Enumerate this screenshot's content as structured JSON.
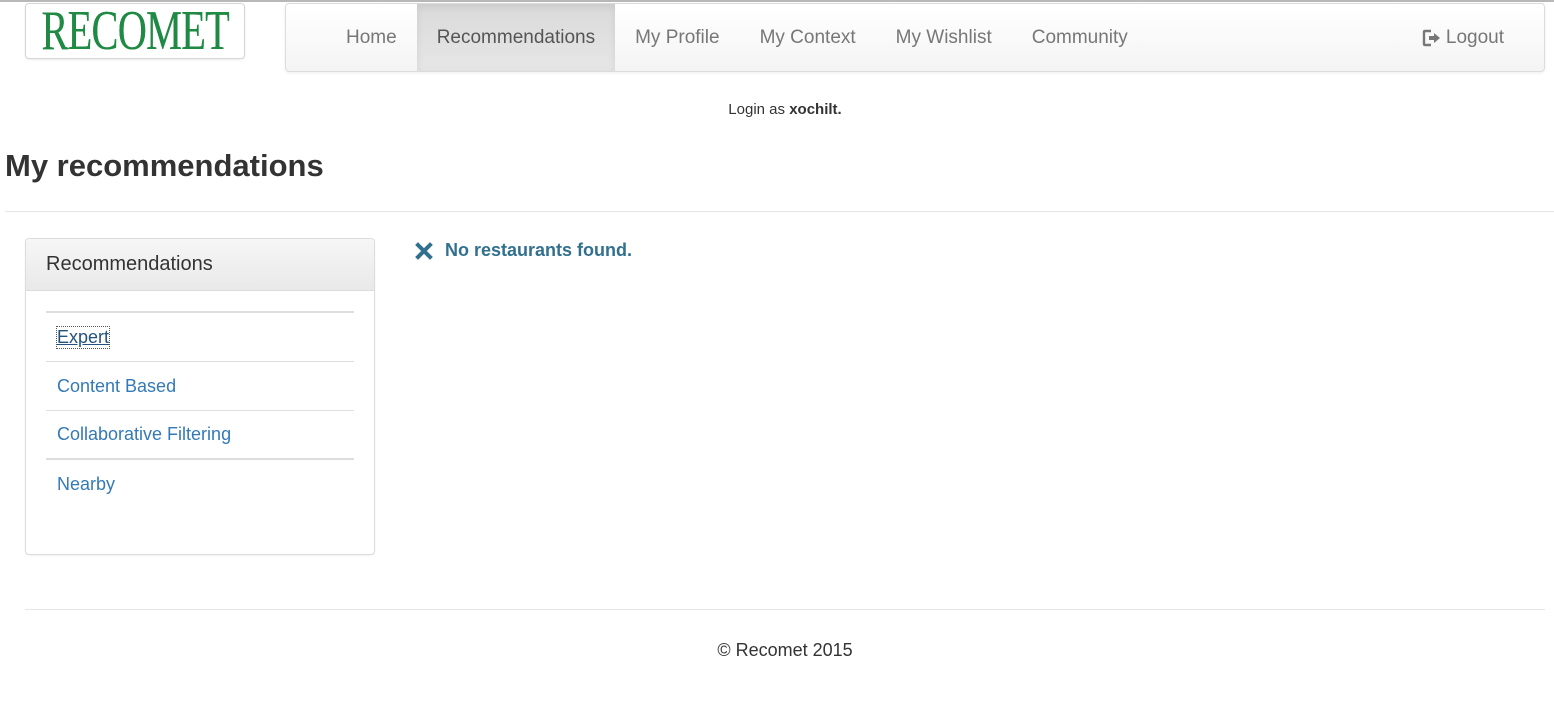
{
  "logo": {
    "text": "RECOMET"
  },
  "nav": {
    "items": [
      {
        "label": "Home",
        "active": false
      },
      {
        "label": "Recommendations",
        "active": true
      },
      {
        "label": "My Profile",
        "active": false
      },
      {
        "label": "My Context",
        "active": false
      },
      {
        "label": "My Wishlist",
        "active": false
      },
      {
        "label": "Community",
        "active": false
      }
    ],
    "logout_label": "Logout",
    "logout_icon": "logout-icon"
  },
  "login": {
    "prefix": "Login as",
    "username": "xochilt."
  },
  "page": {
    "title": "My recommendations"
  },
  "sidebar": {
    "heading": "Recommendations",
    "items": [
      {
        "label": "Expert"
      },
      {
        "label": "Content Based"
      },
      {
        "label": "Collaborative Filtering"
      },
      {
        "label": "Nearby"
      }
    ]
  },
  "alert": {
    "icon": "close-icon",
    "message": "No restaurants found."
  },
  "footer": {
    "text": "© Recomet 2015"
  },
  "colors": {
    "logo_green": "#1f8a43",
    "link_blue": "#337ab7",
    "alert_text": "#31708f",
    "nav_text": "#777777"
  }
}
